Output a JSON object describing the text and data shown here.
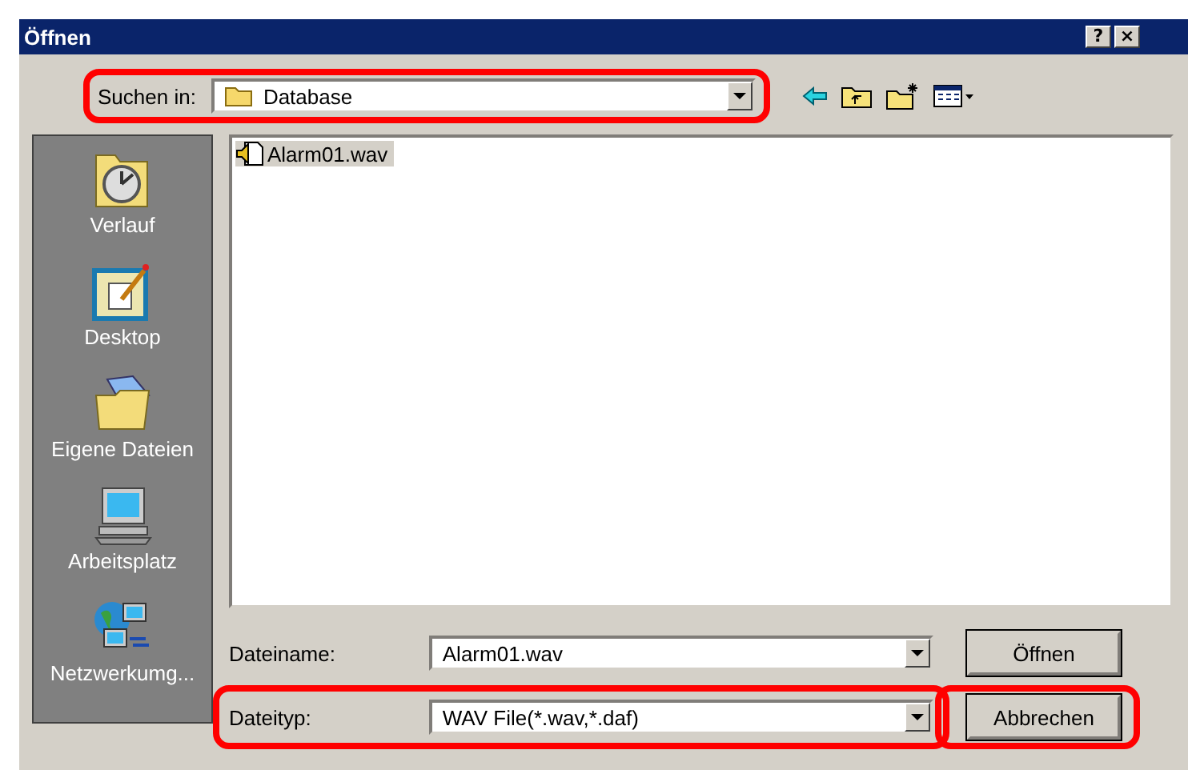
{
  "window": {
    "title": "Öffnen",
    "title_buttons": [
      "?",
      "×"
    ]
  },
  "look_in": {
    "label": "Suchen in:",
    "value": "Database",
    "highlighted": true
  },
  "toolbar": [
    {
      "kind": "back"
    },
    {
      "kind": "up"
    },
    {
      "kind": "new-folder"
    },
    {
      "kind": "view-menu"
    }
  ],
  "places": [
    {
      "label": "Verlauf",
      "kind": "history"
    },
    {
      "label": "Desktop",
      "kind": "desktop"
    },
    {
      "label": "Eigene Dateien",
      "kind": "documents"
    },
    {
      "label": "Arbeitsplatz",
      "kind": "computer"
    },
    {
      "label": "Netzwerkumg...",
      "kind": "network"
    }
  ],
  "files": [
    {
      "name": "Alarm01.wav",
      "selected": true
    }
  ],
  "fields": [
    {
      "label": "Dateiname:",
      "value": "Alarm01.wav",
      "highlighted": false
    },
    {
      "label": "Dateityp:",
      "value": "WAV File(*.wav,*.daf)",
      "highlighted": true
    }
  ],
  "buttons": [
    {
      "label": "Öffnen",
      "highlighted": false
    },
    {
      "label": "Abbrechen",
      "highlighted": true
    }
  ]
}
